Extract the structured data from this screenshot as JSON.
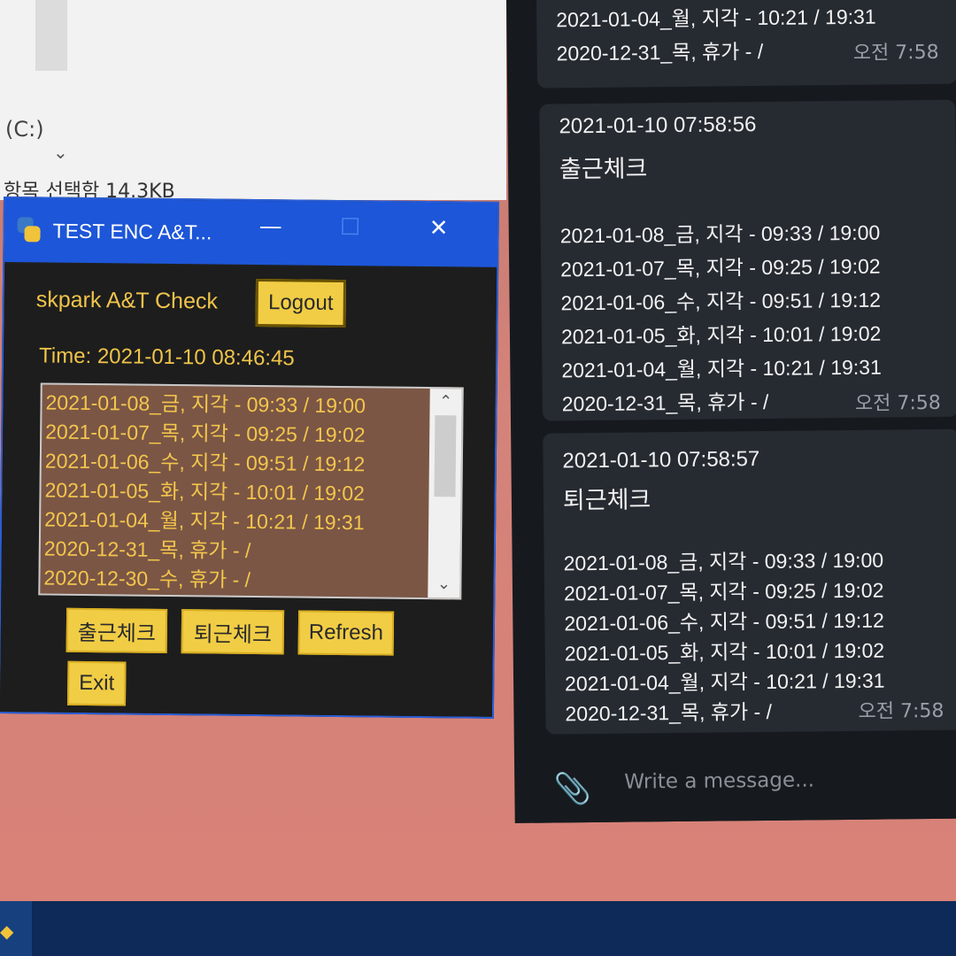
{
  "explorer": {
    "drive_label": "(C:)",
    "status_text": "항목 선택함 14.3KB"
  },
  "app": {
    "title": "TEST ENC A&T...",
    "minimize_glyph": "—",
    "maximize_glyph": "☐",
    "close_glyph": "✕",
    "user_label": "skpark A&T Check",
    "logout_label": "Logout",
    "time_label": "Time: 2021-01-10 08:46:45",
    "records": [
      "2021-01-08_금, 지각 - 09:33 / 19:00",
      "2021-01-07_목, 지각 - 09:25 / 19:02",
      "2021-01-06_수, 지각 - 09:51 / 19:12",
      "2021-01-05_화, 지각 - 10:01 / 19:02",
      "2021-01-04_월, 지각 - 10:21 / 19:31",
      "2020-12-31_목, 휴가 -  /",
      "2020-12-30_수, 휴가 -  /"
    ],
    "btn_checkin": "출근체크",
    "btn_checkout": "퇴근체크",
    "btn_refresh": "Refresh",
    "btn_exit": "Exit",
    "scroll_up": "⌃",
    "scroll_down": "⌄"
  },
  "chat": {
    "msg1": {
      "lines": [
        "2021-01-04_월, 지각 - 10:21 / 19:31",
        "2020-12-31_목, 휴가 - /"
      ],
      "time": "오전 7:58"
    },
    "msg2": {
      "stamp": "2021-01-10 07:58:56",
      "heading": "출근체크",
      "lines": [
        "2021-01-08_금, 지각 - 09:33 / 19:00",
        "2021-01-07_목, 지각 - 09:25 / 19:02",
        "2021-01-06_수, 지각 - 09:51 / 19:12",
        "2021-01-05_화, 지각 - 10:01 / 19:02",
        "2021-01-04_월, 지각 - 10:21 / 19:31",
        "2020-12-31_목, 휴가 - /"
      ],
      "time": "오전 7:58"
    },
    "msg3": {
      "stamp": "2021-01-10 07:58:57",
      "heading": "퇴근체크",
      "lines": [
        "2021-01-08_금, 지각 - 09:33 / 19:00",
        "2021-01-07_목, 지각 - 09:25 / 19:02",
        "2021-01-06_수, 지각 - 09:51 / 19:12",
        "2021-01-05_화, 지각 - 10:01 / 19:02",
        "2021-01-04_월, 지각 - 10:21 / 19:31",
        "2020-12-31_목, 휴가 - /"
      ],
      "time": "오전 7:58"
    },
    "composer_placeholder": "Write a message...",
    "attach_icon": "paperclip-icon"
  },
  "colors": {
    "app_accent": "#f1cd45",
    "app_text": "#f0c44a",
    "titlebar": "#1d56d8",
    "listbox_bg": "#7b5645",
    "chat_bg": "#161a1f",
    "bubble_bg": "#262a31"
  }
}
